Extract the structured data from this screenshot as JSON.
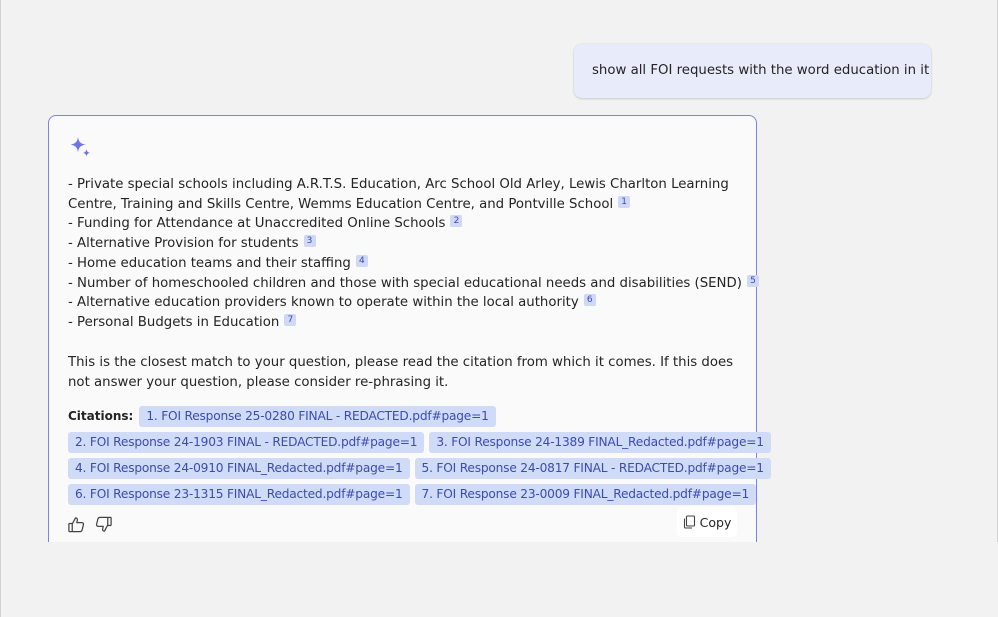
{
  "user_message": "show all FOI requests with the word education in it",
  "assistant": {
    "icon": "sparkle-icon",
    "answer_lines": [
      {
        "text": "- Private special schools including A.R.T.S. Education, Arc School Old Arley, Lewis Charlton Learning Centre, Training and Skills Centre, Wemms Education Centre, and Pontville School",
        "ref": "1"
      },
      {
        "text": "- Funding for Attendance at Unaccredited Online Schools",
        "ref": "2"
      },
      {
        "text": "- Alternative Provision for students",
        "ref": "3"
      },
      {
        "text": "- Home education teams and their staffing",
        "ref": "4"
      },
      {
        "text": "- Number of homeschooled children and those with special educational needs and disabilities (SEND)",
        "ref": "5"
      },
      {
        "text": "- Alternative education providers known to operate within the local authority",
        "ref": "6"
      },
      {
        "text": "- Personal Budgets in Education",
        "ref": "7"
      }
    ],
    "closing": "This is the closest match to your question, please read the citation from which it comes. If this does not answer your question, please consider re-phrasing it.",
    "citations_label": "Citations:",
    "citations": [
      "1. FOI Response 25-0280 FINAL - REDACTED.pdf#page=1",
      "2. FOI Response 24-1903 FINAL - REDACTED.pdf#page=1",
      "3. FOI Response 24-1389 FINAL_Redacted.pdf#page=1",
      "4. FOI Response 24-0910 FINAL_Redacted.pdf#page=1",
      "5. FOI Response 24-0817 FINAL - REDACTED.pdf#page=1",
      "6. FOI Response 23-1315 FINAL_Redacted.pdf#page=1",
      "7. FOI Response 23-0009 FINAL_Redacted.pdf#page=1"
    ],
    "copy_label": "Copy",
    "accent_color": "#7b83eb"
  }
}
